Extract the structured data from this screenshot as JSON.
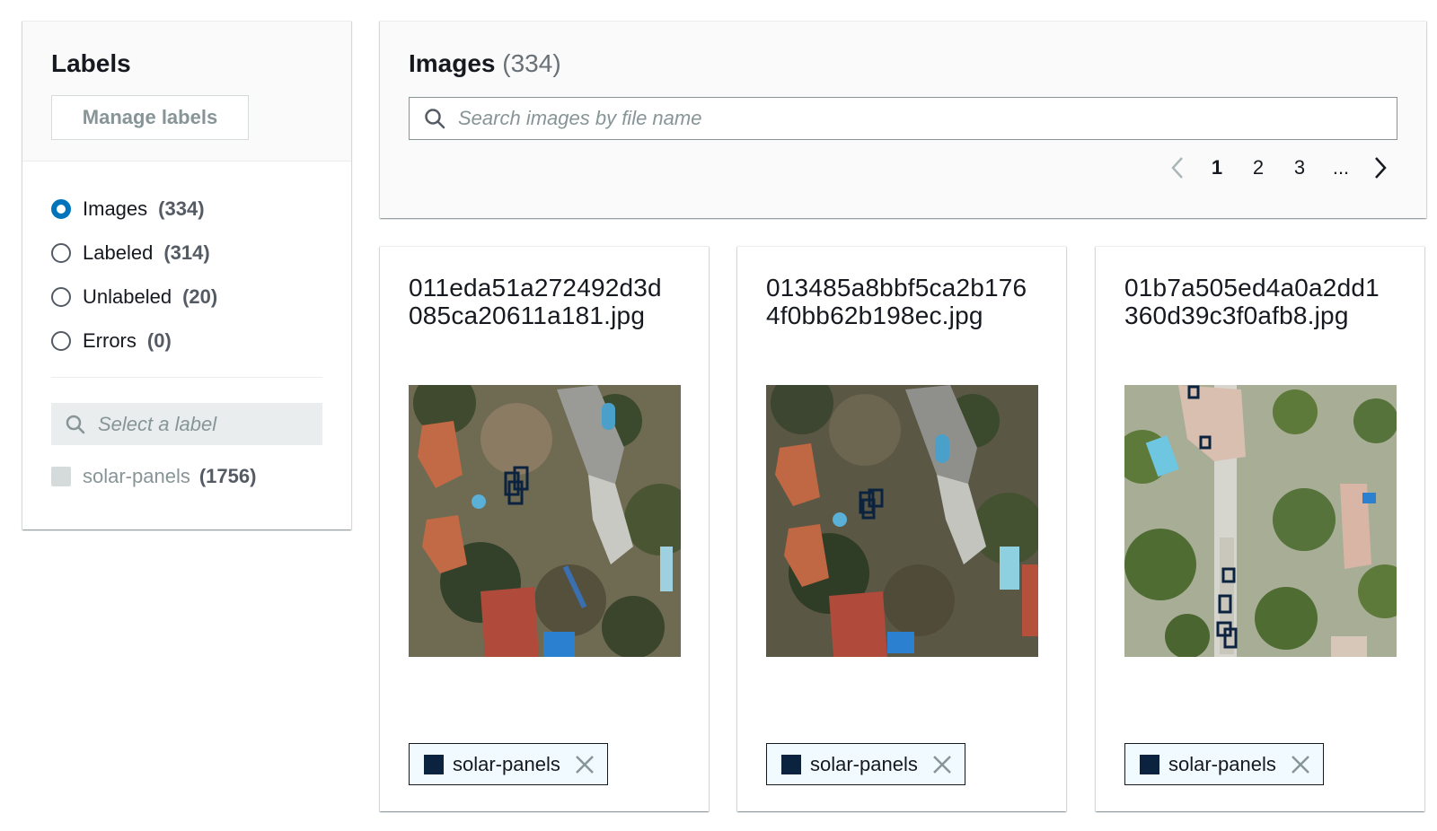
{
  "labels_panel": {
    "title": "Labels",
    "manage_button": "Manage labels",
    "filters": [
      {
        "name": "Images",
        "count": "(334)",
        "selected": true
      },
      {
        "name": "Labeled",
        "count": "(314)",
        "selected": false
      },
      {
        "name": "Unlabeled",
        "count": "(20)",
        "selected": false
      },
      {
        "name": "Errors",
        "count": "(0)",
        "selected": false
      }
    ],
    "label_search_placeholder": "Select a label",
    "labels": [
      {
        "name": "solar-panels",
        "count": "(1756)",
        "color": "#0c2340"
      }
    ]
  },
  "images_panel": {
    "title": "Images",
    "count": "(334)",
    "search_placeholder": "Search images by file name",
    "pagination": {
      "pages": [
        "1",
        "2",
        "3",
        "..."
      ],
      "current": "1"
    }
  },
  "cards": [
    {
      "filename_line1": "011eda51a272492d3d",
      "filename_line2": "085ca20611a181.jpg",
      "tag": "solar-panels"
    },
    {
      "filename_line1": "013485a8bbf5ca2b176",
      "filename_line2": "4f0bb62b198ec.jpg",
      "tag": "solar-panels"
    },
    {
      "filename_line1": "01b7a505ed4a0a2dd1",
      "filename_line2": "360d39c3f0afb8.jpg",
      "tag": "solar-panels"
    }
  ],
  "colors": {
    "accent": "#0073bb",
    "label_color": "#0c2340",
    "tag_bg": "#f1faff"
  }
}
